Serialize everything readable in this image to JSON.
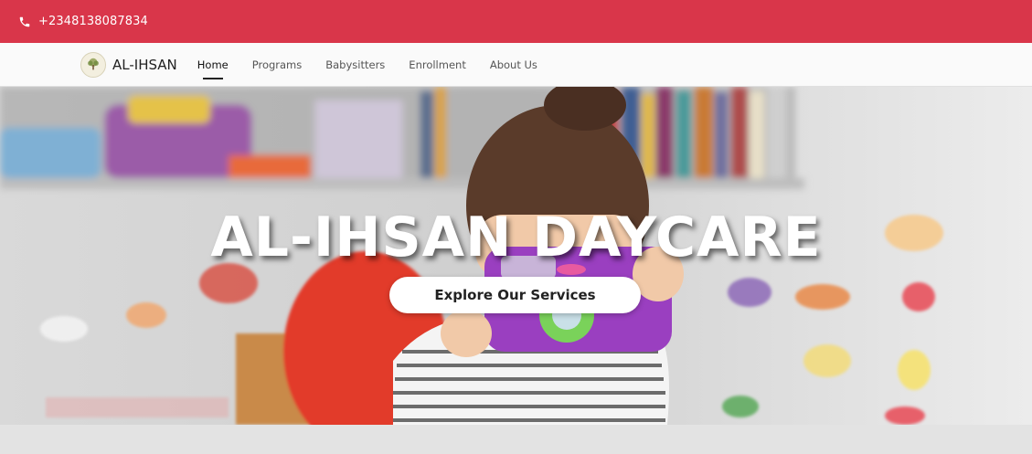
{
  "topbar": {
    "phone_icon": "phone-icon",
    "phone": "+2348138087834",
    "background": "#d9364a"
  },
  "navbar": {
    "logo_icon": "tree-logo-icon",
    "brand": "AL-IHSAN",
    "links": [
      {
        "label": "Home",
        "active": true
      },
      {
        "label": "Programs",
        "active": false
      },
      {
        "label": "Babysitters",
        "active": false
      },
      {
        "label": "Enrollment",
        "active": false
      },
      {
        "label": "About Us",
        "active": false
      }
    ]
  },
  "hero": {
    "title": "AL-IHSAN DAYCARE",
    "cta": "Explore Our Services",
    "image": "child-with-toy-camera-photo"
  }
}
